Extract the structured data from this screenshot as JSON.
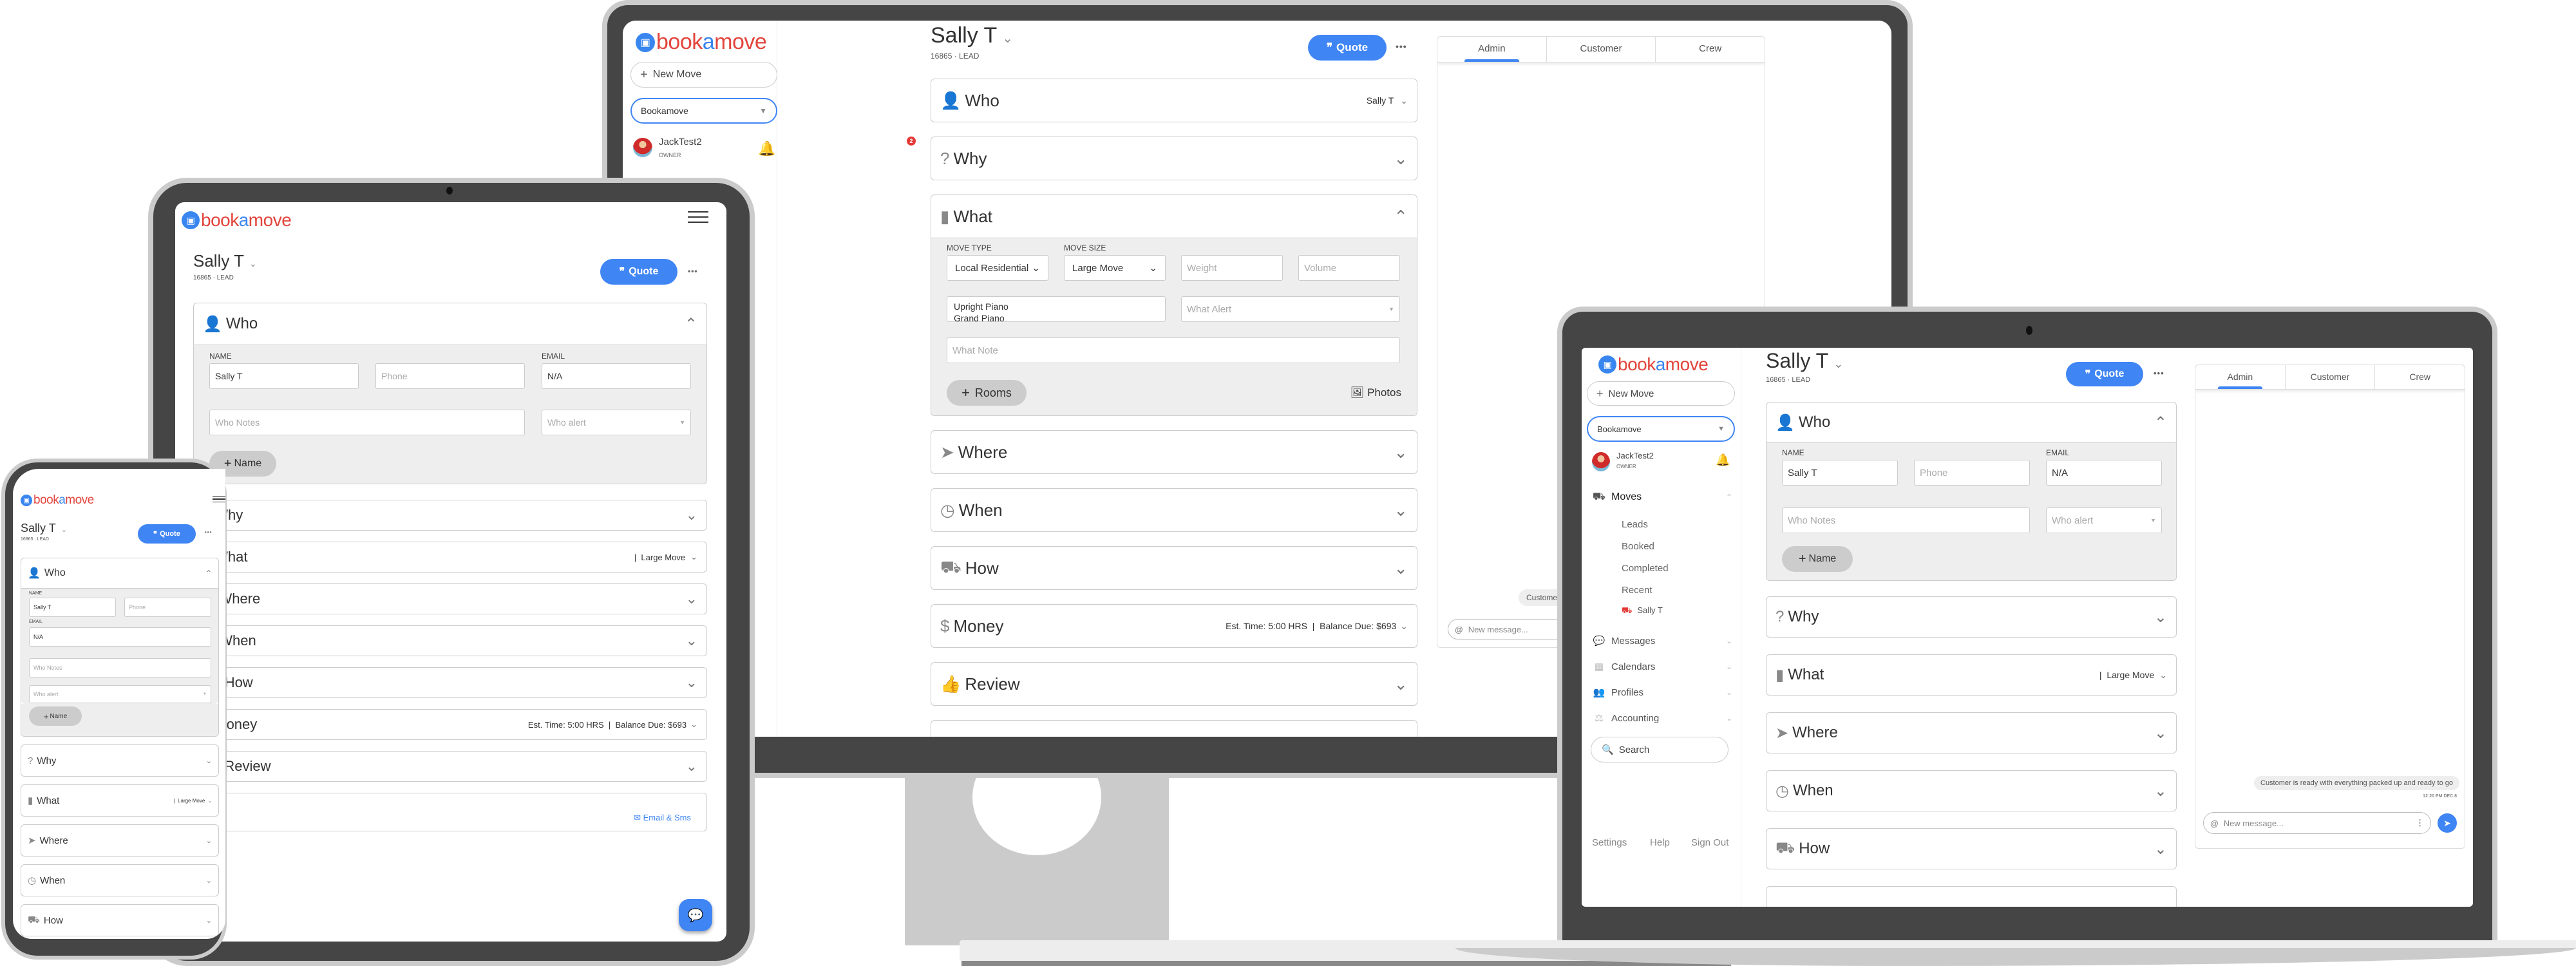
{
  "app": {
    "brand_prefix": "book",
    "brand_a": "a",
    "brand_suffix": "move",
    "logo_icon": "truck-icon"
  },
  "move": {
    "title": "Sally T",
    "subtitle": "16865 · LEAD",
    "quote_label": "Quote",
    "quote_icon": "quote-icon",
    "more_label": "•••"
  },
  "sidebar": {
    "new_move_label": "New Move",
    "company_select": "Bookamove",
    "user_name": "JackTest2",
    "user_role": "OWNER",
    "notification_count": "2",
    "nav": [
      {
        "label": "Moves",
        "icon": "truck-icon",
        "expanded": true
      },
      {
        "label": "Messages",
        "icon": "chat-bubble-icon"
      },
      {
        "label": "Calendars",
        "icon": "calendar-icon"
      },
      {
        "label": "Profiles",
        "icon": "users-icon"
      },
      {
        "label": "Accounting",
        "icon": "scale-icon"
      }
    ],
    "moves_sub": [
      "Leads",
      "Booked",
      "Completed",
      "Recent"
    ],
    "recent_move": "Sally T",
    "search_label": "Search",
    "footer": [
      "Settings",
      "Help",
      "Sign Out"
    ]
  },
  "sections": {
    "who": {
      "label": "Who",
      "summary": "Sally T"
    },
    "why": {
      "label": "Why"
    },
    "what": {
      "label": "What",
      "summary": "|  Large Move"
    },
    "where": {
      "label": "Where"
    },
    "when": {
      "label": "When"
    },
    "how": {
      "label": "How"
    },
    "money": {
      "label": "Money",
      "summary": "Est. Time: 5:00 HRS  |  Balance Due: $693"
    },
    "review": {
      "label": "Review"
    }
  },
  "who_form": {
    "name_label": "NAME",
    "email_label": "EMAIL",
    "name_value": "Sally T",
    "phone_placeholder": "Phone",
    "email_value": "N/A",
    "notes_placeholder": "Who Notes",
    "alert_placeholder": "Who alert",
    "add_name_label": "Name"
  },
  "what_form": {
    "move_type_label": "MOVE TYPE",
    "move_size_label": "MOVE SIZE",
    "move_type_value": "Local Residential",
    "move_size_value": "Large Move",
    "weight_placeholder": "Weight",
    "volume_placeholder": "Volume",
    "items_line1": "Upright Piano",
    "items_line2": "Grand Piano",
    "alert_placeholder": "What Alert",
    "note_placeholder": "What Note",
    "rooms_label": "Rooms",
    "photos_label": "Photos"
  },
  "chat": {
    "tabs": [
      "Admin",
      "Customer",
      "Crew"
    ],
    "active_tab": "Admin",
    "message": "Customer is ready with everything packed up and ready to go",
    "message_time": "12:20 PM DEC 8",
    "input_placeholder": "New message...",
    "email_sms_label": "Email & Sms"
  },
  "colors": {
    "accent": "#3f85f4",
    "brand_red": "#e2453c",
    "bezel": "#454545",
    "frame": "#cbcbcb"
  }
}
